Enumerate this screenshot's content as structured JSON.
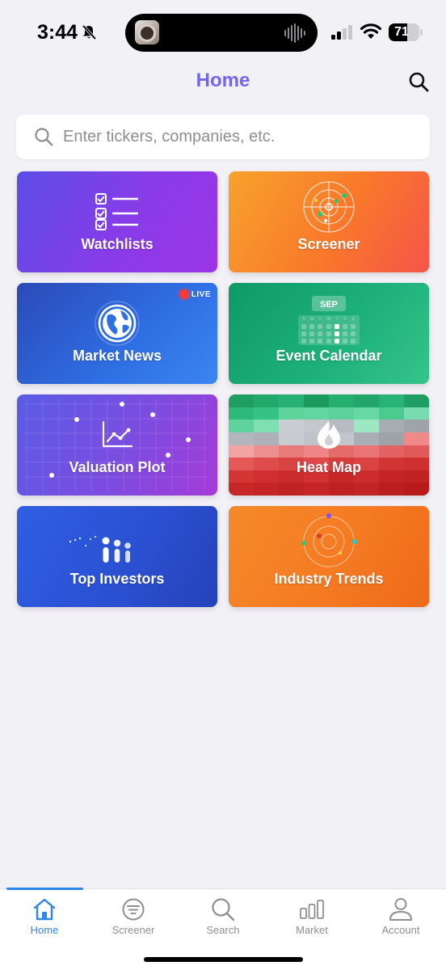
{
  "status_bar": {
    "time": "3:44",
    "battery": "71",
    "battery_level": 0.71
  },
  "header": {
    "title": "Home"
  },
  "search": {
    "placeholder": "Enter tickers, companies, etc."
  },
  "tiles": [
    {
      "label": "Watchlists",
      "icon": "checklist-icon"
    },
    {
      "label": "Screener",
      "icon": "radar-icon"
    },
    {
      "label": "Market News",
      "icon": "globe-icon",
      "badge": "LIVE"
    },
    {
      "label": "Event Calendar",
      "icon": "calendar-icon",
      "month": "SEP"
    },
    {
      "label": "Valuation Plot",
      "icon": "line-chart-icon"
    },
    {
      "label": "Heat Map",
      "icon": "flame-icon"
    },
    {
      "label": "Top Investors",
      "icon": "investors-icon"
    },
    {
      "label": "Industry Trends",
      "icon": "orbit-icon"
    }
  ],
  "tabs": [
    {
      "label": "Home",
      "icon": "home-icon",
      "active": true
    },
    {
      "label": "Screener",
      "icon": "filter-icon",
      "active": false
    },
    {
      "label": "Search",
      "icon": "search-icon",
      "active": false
    },
    {
      "label": "Market",
      "icon": "bar-chart-icon",
      "active": false
    },
    {
      "label": "Account",
      "icon": "user-icon",
      "active": false
    }
  ],
  "colors": {
    "accent": "#2f86e6",
    "title_gradient_start": "#4a7bf0",
    "title_gradient_end": "#9f4cf0",
    "live": "#f23b3b"
  }
}
